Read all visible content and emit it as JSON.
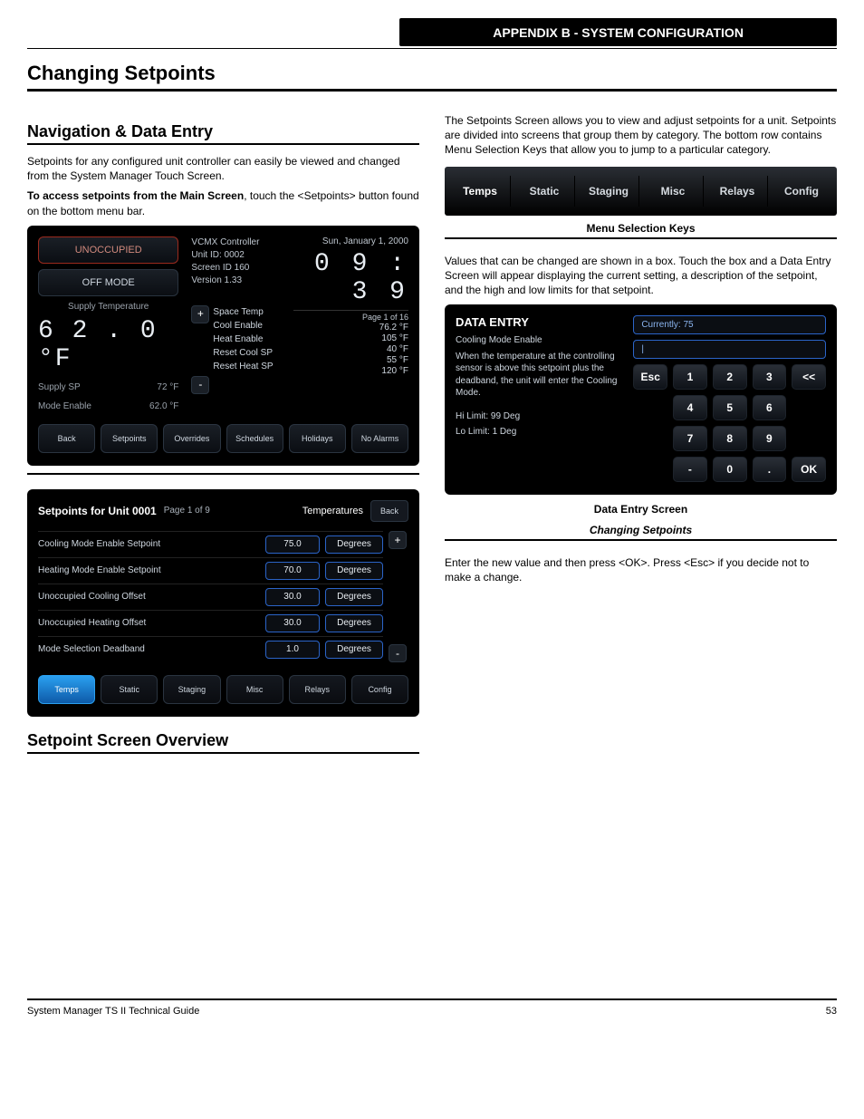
{
  "header": {
    "section_title": "APPENDIX B - SYSTEM CONFIGURATION"
  },
  "page_title": "Changing Setpoints",
  "intro": {
    "heading": "Navigation & Data Entry",
    "p1": "Setpoints for any configured unit controller can easily be viewed and changed from the System Manager Touch Screen.",
    "p2_bold_lead": "To access setpoints from the Main Screen",
    "p2_rest": ", touch the <Setpoints> button found on the bottom menu bar."
  },
  "status_screen": {
    "badge_unoccupied": "UNOCCUPIED",
    "badge_offmode": "OFF MODE",
    "label_supply_temp": "Supply Temperature",
    "temp_value": "6 2 . 0 °F",
    "supply_sp_label": "Supply SP",
    "supply_sp_val": "72 °F",
    "mode_enable_label": "Mode Enable",
    "mode_enable_val": "62.0 °F",
    "ctrl_label": "VCMX Controller",
    "unit_id": "Unit ID: 0002",
    "screen_id": "Screen ID  160",
    "version": "Version  1.33",
    "date": "Sun, January 1, 2000",
    "clock": "0 9 : 3 9",
    "page": "Page 1 of 16",
    "rows": [
      {
        "l": "Space Temp",
        "r": "76.2 °F"
      },
      {
        "l": "Cool Enable",
        "r": "105 °F"
      },
      {
        "l": "Heat Enable",
        "r": "40 °F"
      },
      {
        "l": "Reset Cool SP",
        "r": "55 °F"
      },
      {
        "l": "Reset Heat SP",
        "r": "120 °F"
      }
    ],
    "nav": [
      "Back",
      "Setpoints",
      "Overrides",
      "Schedules",
      "Holidays",
      "No Alarms"
    ]
  },
  "sp_screen": {
    "title": "Setpoints for Unit 0001",
    "page": "Page 1 of 9",
    "tab_label": "Temperatures",
    "back": "Back",
    "rows": [
      {
        "name": "Cooling Mode Enable Setpoint",
        "val": "75.0",
        "unit": "Degrees"
      },
      {
        "name": "Heating Mode Enable Setpoint",
        "val": "70.0",
        "unit": "Degrees"
      },
      {
        "name": "Unoccupied Cooling Offset",
        "val": "30.0",
        "unit": "Degrees"
      },
      {
        "name": "Unoccupied Heating Offset",
        "val": "30.0",
        "unit": "Degrees"
      },
      {
        "name": "Mode Selection Deadband",
        "val": "1.0",
        "unit": "Degrees"
      }
    ],
    "tabs": [
      "Temps",
      "Static",
      "Staging",
      "Misc",
      "Relays",
      "Config"
    ]
  },
  "mid_heading": "Setpoint Screen Overview",
  "right": {
    "p_menu1": "The Setpoints Screen allows you to view and adjust setpoints for a unit. Setpoints are divided into screens that group them by category. The bottom row contains Menu Selection Keys that allow you to jump to a particular category.",
    "menu_keys": [
      "Temps",
      "Static",
      "Staging",
      "Misc",
      "Relays",
      "Config"
    ],
    "menu_caption": "Menu Selection Keys",
    "hr_label": "",
    "p_value1": "Values that can be changed are shown in a box. Touch the box and a Data Entry Screen will appear displaying the current setting, a description of the setpoint, and the high and low limits for that setpoint.",
    "de_title": "DATA ENTRY",
    "de_current": "Currently: 75",
    "de_cursor": "|",
    "de_name": "Cooling Mode Enable",
    "de_text": "When the temperature at the controlling sensor is above this setpoint plus the deadband, the unit will enter the Cooling Mode.",
    "de_hi": "Hi  Limit: 99 Deg",
    "de_lo": "Lo Limit:   1 Deg",
    "keypad": [
      [
        "Esc",
        "1",
        "2",
        "3",
        "<<"
      ],
      [
        "",
        "4",
        "5",
        "6",
        ""
      ],
      [
        "",
        "7",
        "8",
        "9",
        ""
      ],
      [
        "",
        "-",
        "0",
        ".",
        "OK"
      ]
    ],
    "de_caption1": "Data Entry Screen",
    "de_caption2": "Changing Setpoints",
    "p_enter": "Enter the new value and then press <OK>. Press <Esc> if you decide not to make a change."
  },
  "footer": {
    "left": "System Manager TS II Technical Guide",
    "right": "53"
  }
}
